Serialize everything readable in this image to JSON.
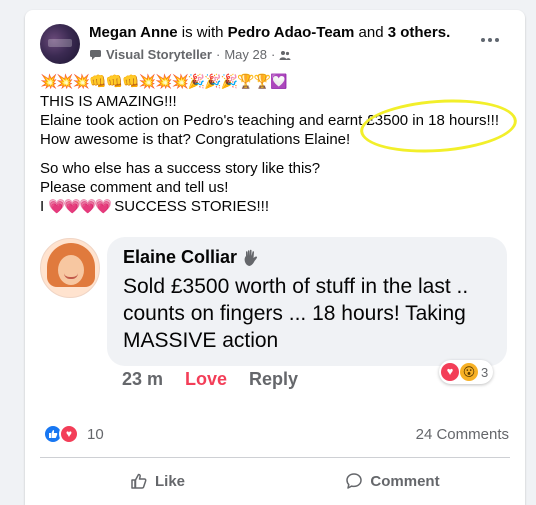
{
  "post": {
    "author": "Megan Anne",
    "with_text": "is with",
    "tagged": "Pedro Adao-Team",
    "and_text": "and",
    "others": "3 others.",
    "badge": "Visual Storyteller",
    "separator": "·",
    "date": "May 28",
    "emoji_row": "💥💥💥👊👊👊💥💥💥🎉🎉🎉🏆🏆💟",
    "line1": "THIS IS AMAZING!!!",
    "line2": "Elaine took action on Pedro's teaching and earnt £3500 in 18 hours!!!",
    "line3": "How awesome is that? Congratulations Elaine!",
    "line4": "So who else has a success story like this?",
    "line5": "Please comment and tell us!",
    "line6_prefix": "I",
    "line6_hearts": "💗💗💗💗",
    "line6_suffix": "SUCCESS STORIES!!!",
    "reaction_count": "10",
    "comments_count": "24 Comments"
  },
  "comment": {
    "name": "Elaine Colliar",
    "text": "Sold £3500 worth of stuff in the last .. counts on fingers ... 18 hours! Taking MASSIVE action",
    "time": "23 m",
    "love_label": "Love",
    "reply_label": "Reply",
    "reaction_count": "3"
  },
  "actions": {
    "like": "Like",
    "comment": "Comment"
  },
  "colors": {
    "like_blue": "#1877f2",
    "love_red": "#f33e58",
    "highlight": "#f2ef2a"
  }
}
